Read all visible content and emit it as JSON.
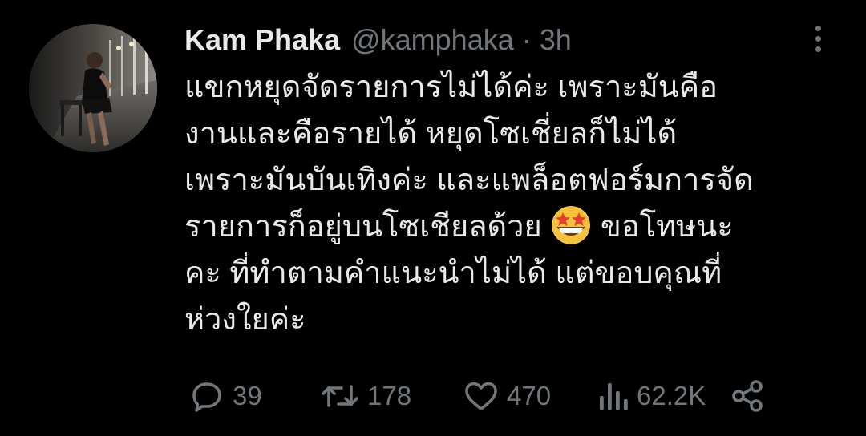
{
  "tweet": {
    "author": {
      "display_name": "Kam Phaka",
      "handle": "@kamphaka",
      "separator": "·",
      "time": "3h",
      "avatar": "profile-photo"
    },
    "text_lines": [
      "แขกหยุดจัดรายการไม่ได้ค่ะ เพราะมันคือ",
      "งานและคือรายได้ หยุดโซเชี่ยลก็ไม่ได้",
      "เพราะมันบันเทิงค่ะ และแพล็อตฟอร์มการจัด",
      "รายการก็อยู่บนโซเชียลด้วย",
      "ขอโทษนะ",
      "คะ ที่ทำตามคำแนะนำไม่ได้ แต่ขอบคุณที่",
      "ห่วงใยค่ะ"
    ],
    "emoji": "star-struck-emoji",
    "metrics": {
      "replies": "39",
      "retweets": "178",
      "likes": "470",
      "views": "62.2K"
    },
    "icons": {
      "reply": "reply-icon",
      "retweet": "retweet-icon",
      "like": "heart-icon",
      "views": "views-icon",
      "share": "share-icon",
      "more": "more-icon"
    }
  },
  "colors": {
    "background": "#000000",
    "primary_text": "#e7e9ea",
    "secondary_text": "#71767b"
  }
}
